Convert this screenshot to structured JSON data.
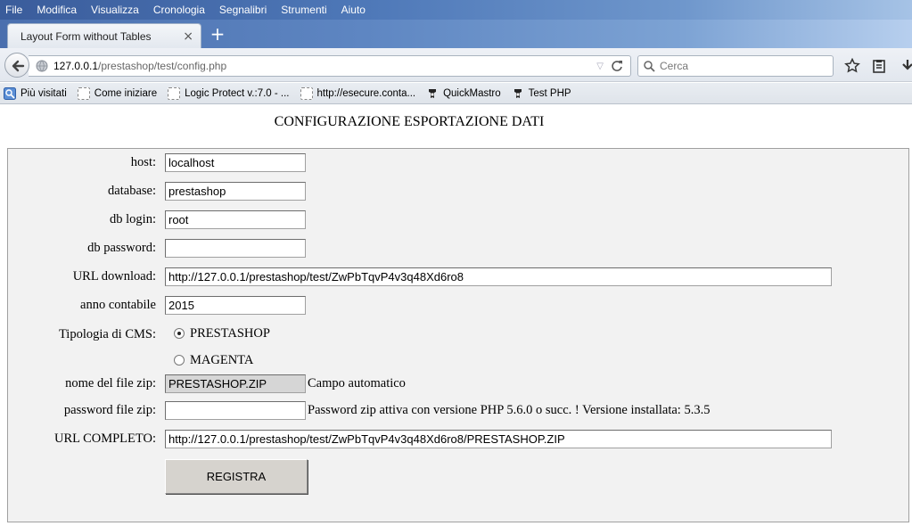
{
  "menubar": {
    "items": [
      "File",
      "Modifica",
      "Visualizza",
      "Cronologia",
      "Segnalibri",
      "Strumenti",
      "Aiuto"
    ]
  },
  "tab": {
    "title": "Layout Form without Tables",
    "close": "×",
    "new": "+"
  },
  "nav": {
    "url_host": "127.0.0.1",
    "url_path": "/prestashop/test/config.php",
    "search_placeholder": "Cerca"
  },
  "bookmarks": [
    {
      "label": "Più visitati",
      "icon": "most-visited-icon"
    },
    {
      "label": "Come iniziare",
      "icon": "blank-page-icon"
    },
    {
      "label": "Logic Protect v.:7.0 - ...",
      "icon": "blank-page-icon"
    },
    {
      "label": "http://esecure.conta...",
      "icon": "blank-page-icon"
    },
    {
      "label": "QuickMastro",
      "icon": "php-icon"
    },
    {
      "label": "Test PHP",
      "icon": "php-icon"
    }
  ],
  "page": {
    "title": "CONFIGURAZIONE ESPORTAZIONE DATI",
    "fields": {
      "host": {
        "label": "host:",
        "value": "localhost"
      },
      "database": {
        "label": "database:",
        "value": "prestashop"
      },
      "db_login": {
        "label": "db login:",
        "value": "root"
      },
      "db_password": {
        "label": "db password:",
        "value": ""
      },
      "url_download": {
        "label": "URL download:",
        "value": "http://127.0.0.1/prestashop/test/ZwPbTqvP4v3q48Xd6ro8"
      },
      "anno": {
        "label": "anno contabile",
        "value": "2015"
      },
      "cms": {
        "label": "Tipologia di CMS:",
        "options": [
          "PRESTASHOP",
          "MAGENTA"
        ],
        "selected": "PRESTASHOP"
      },
      "zip_name": {
        "label": "nome del file zip:",
        "value": "PRESTASHOP.ZIP",
        "note": "Campo automatico"
      },
      "zip_password": {
        "label": "password file zip:",
        "value": "",
        "note": "Password zip attiva con versione PHP 5.6.0 o succ. ! Versione installata: 5.3.5"
      },
      "url_completo": {
        "label": "URL COMPLETO:",
        "value": "http://127.0.0.1/prestashop/test/ZwPbTqvP4v3q48Xd6ro8/PRESTASHOP.ZIP"
      }
    },
    "submit_label": "REGISTRA"
  }
}
